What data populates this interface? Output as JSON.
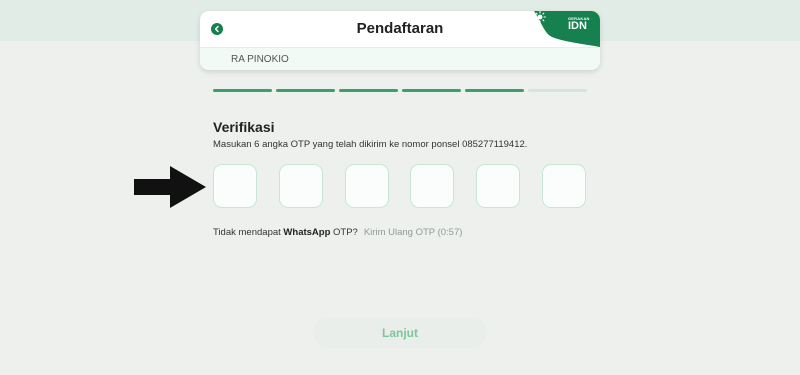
{
  "header": {
    "title": "Pendaftaran",
    "school_name": "RA PINOKIO",
    "brand_small": "GERAKAN",
    "brand_name": "IDN"
  },
  "progress": {
    "total_steps": 6,
    "completed_steps": 5
  },
  "verification": {
    "title": "Verifikasi",
    "instruction": "Masukan 6 angka OTP yang telah dikirim ke nomor ponsel 085277119412.",
    "otp_values": [
      "",
      "",
      "",
      "",
      "",
      ""
    ]
  },
  "resend": {
    "text_before": "Tidak mendapat ",
    "channel": "WhatsApp",
    "text_after": " OTP?",
    "link": "Kirim Ulang OTP (0:57)"
  },
  "actions": {
    "next_label": "Lanjut"
  },
  "colors": {
    "accent": "#16804e",
    "progress_done": "#3a9f68",
    "progress_todo": "#d3e5dc",
    "otp_border": "#c7e6d6",
    "button_text": "#7fc69d"
  },
  "icons": {
    "back": "chevron-left-icon",
    "brand": "sun-icon",
    "annotation": "arrow-right-icon"
  }
}
